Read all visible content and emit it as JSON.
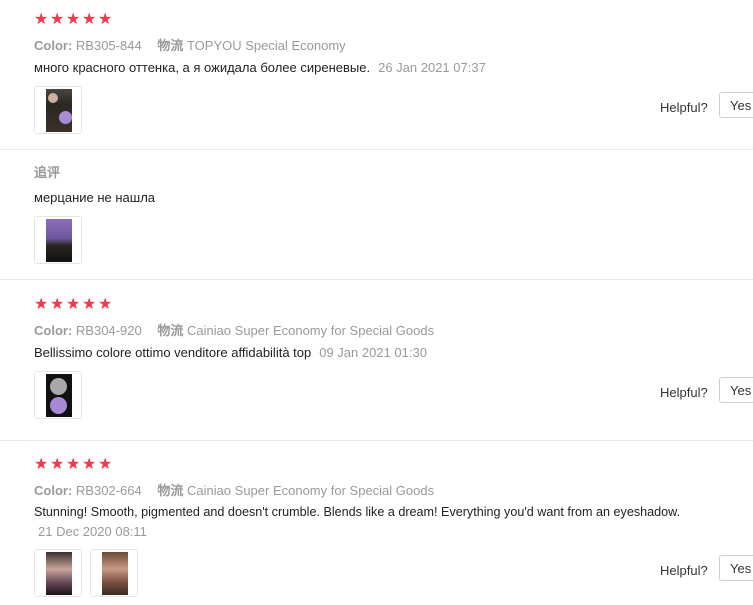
{
  "reviews": [
    {
      "stars": 5,
      "color_label": "Color:",
      "color_value": "RB305-844",
      "shipping_label": "物流",
      "shipping_value": "TOPYOU Special Economy",
      "text": "много красного оттенка, а я ожидала более сиреневые.",
      "date": "26 Jan 2021 07:37",
      "helpful_label": "Helpful?",
      "yes_label": "Yes",
      "additional": {
        "title": "追评",
        "text": "мерцание не нашла"
      }
    },
    {
      "stars": 5,
      "color_label": "Color:",
      "color_value": "RB304-920",
      "shipping_label": "物流",
      "shipping_value": "Cainiao Super Economy for Special Goods",
      "text": "Bellissimo colore ottimo venditore affidabilità top",
      "date": "09 Jan 2021 01:30",
      "helpful_label": "Helpful?",
      "yes_label": "Yes"
    },
    {
      "stars": 5,
      "color_label": "Color:",
      "color_value": "RB302-664",
      "shipping_label": "物流",
      "shipping_value": "Cainiao Super Economy for Special Goods",
      "text": "Stunning! Smooth, pigmented and doesn't crumble. Blends like a dream! Everything you'd want from an eyeshadow.",
      "date": "21 Dec 2020 08:11",
      "helpful_label": "Helpful?",
      "yes_label": "Yes"
    }
  ],
  "star_glyph": "★",
  "colors": {
    "star": "#f0394a",
    "muted": "#999999",
    "divider": "#e8e8e8"
  }
}
